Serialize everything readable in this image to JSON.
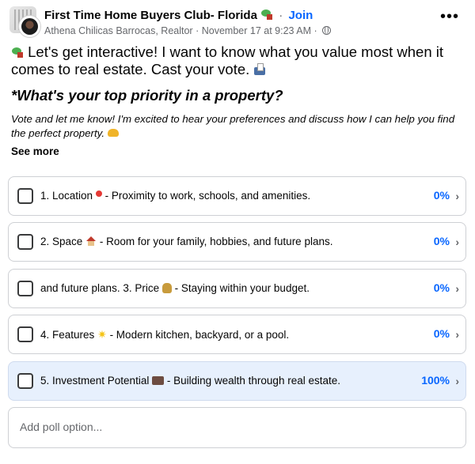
{
  "post": {
    "group_name": "First Time Home Buyers Club- Florida",
    "separator": "·",
    "join_label": "Join",
    "author": "Athena Chilicas Barrocas, Realtor",
    "timestamp": "November 17 at 9:23 AM",
    "meta_separator": "·",
    "more_label": "•••",
    "intro_text": "Let's get interactive! I want to know what you value most when it comes to real estate. Cast your vote.",
    "question": "*What's your top priority in a property?",
    "description": "Vote and let me know! I'm excited to hear your preferences and discuss how I can help you find the perfect property.",
    "see_more_label": "See more"
  },
  "poll": {
    "options": [
      {
        "pre": "1. Location",
        "icon": "pin-icon",
        "post": "- Proximity to work, schools, and amenities.",
        "percent": "0%"
      },
      {
        "pre": "2. Space",
        "icon": "house-icon",
        "post": "- Room for your family, hobbies, and future plans.",
        "percent": "0%"
      },
      {
        "pre": "and future plans. 3. Price",
        "icon": "money-bag-icon",
        "post": "- Staying within your budget.",
        "percent": "0%"
      },
      {
        "pre": "4. Features",
        "icon": "sparkle-icon",
        "post": "- Modern kitchen, backyard, or a pool.",
        "percent": "0%"
      },
      {
        "pre": "5. Investment Potential",
        "icon": "briefcase-icon",
        "post": "- Building wealth through real estate.",
        "percent": "100%"
      }
    ],
    "add_option_placeholder": "Add poll option..."
  },
  "colors": {
    "link_blue": "#0866ff",
    "selected_bg": "#e7f0fd",
    "secondary_text": "#65676b"
  }
}
